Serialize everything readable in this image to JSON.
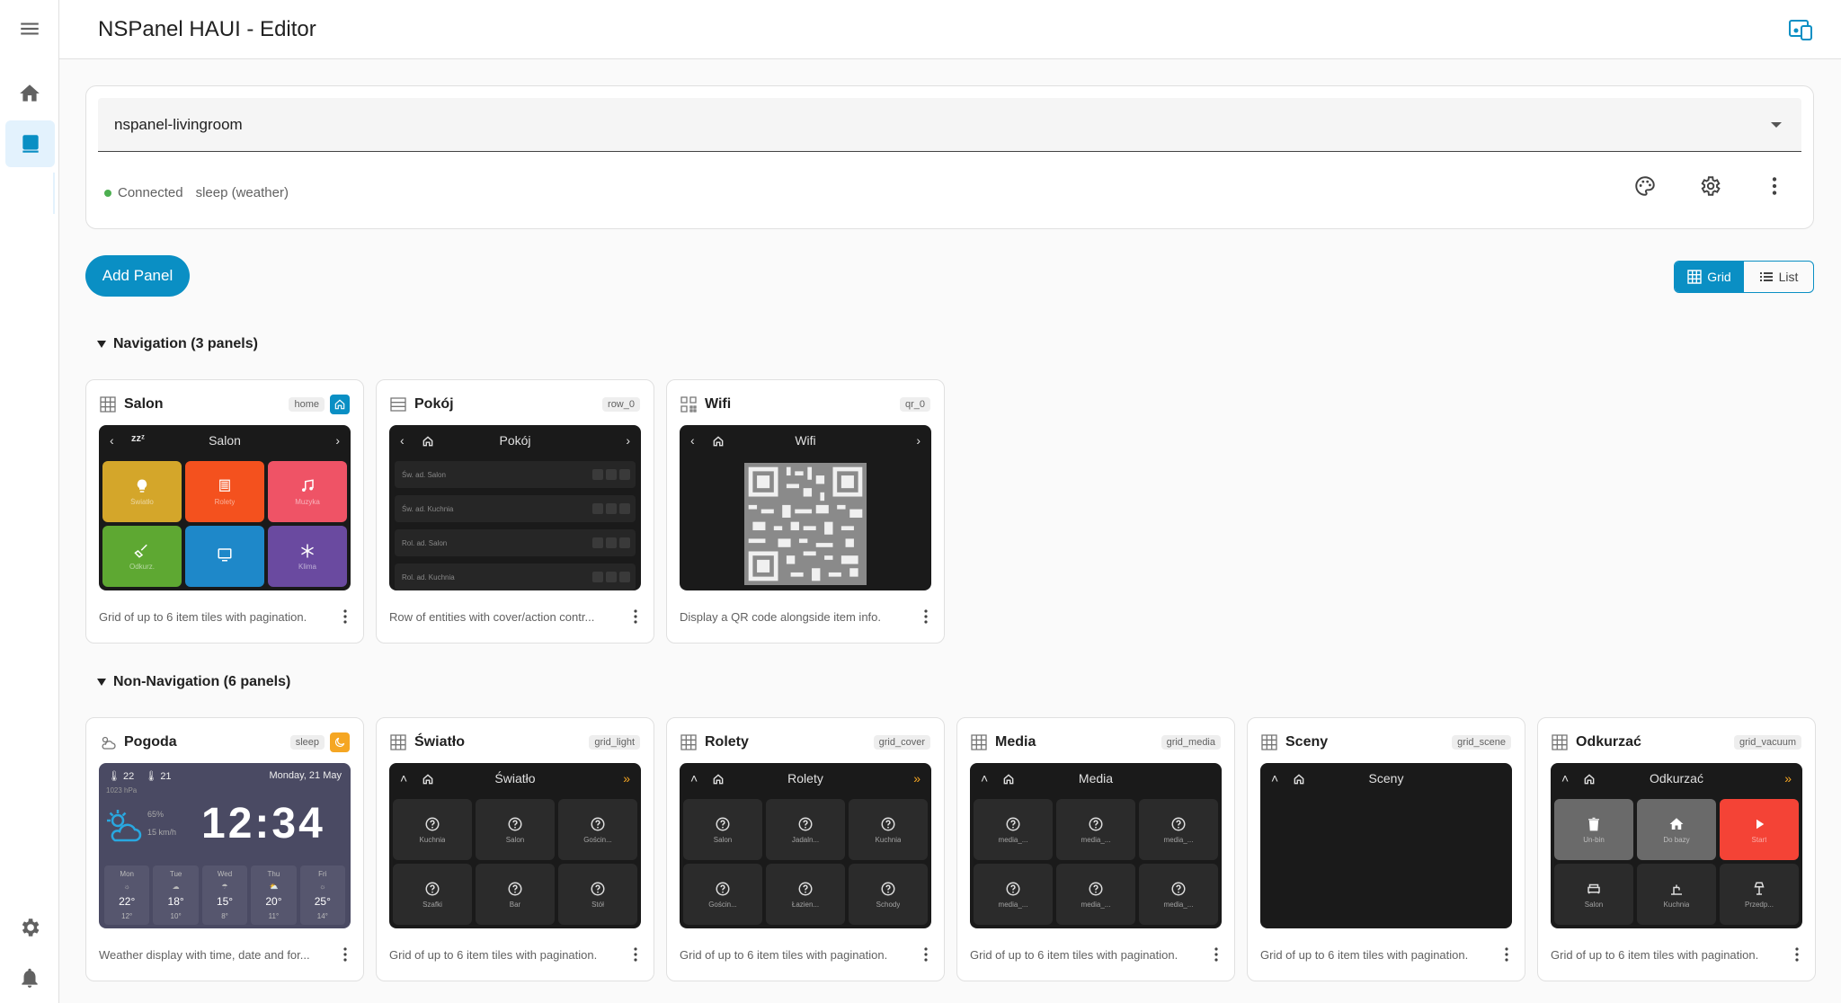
{
  "header": {
    "title": "NSPanel HAUI - Editor"
  },
  "device": {
    "selected": "nspanel-livingroom",
    "status": "Connected",
    "mode": "sleep (weather)"
  },
  "toolbar": {
    "add_panel": "Add Panel",
    "view_grid": "Grid",
    "view_list": "List"
  },
  "sections": {
    "navigation": "Navigation (3 panels)",
    "non_navigation": "Non-Navigation (6 panels)"
  },
  "colors": {
    "accent": "#0a8fc4",
    "connected": "#4caf50",
    "sleep_badge": "#f5a623"
  },
  "panels": {
    "salon": {
      "name": "Salon",
      "tag": "home",
      "title": "Salon",
      "tiles": [
        "Światło",
        "Rolety",
        "Muzyka",
        "Odkurz.",
        "",
        "Klima"
      ],
      "desc": "Grid of up to 6 item tiles with pagination."
    },
    "pokoj": {
      "name": "Pokój",
      "tag": "row_0",
      "title": "Pokój",
      "rows": [
        "Św. ad. Salon",
        "Św. ad. Kuchnia",
        "Rol. ad. Salon",
        "Rol. ad. Kuchnia"
      ],
      "desc": "Row of entities with cover/action contr..."
    },
    "wifi": {
      "name": "Wifi",
      "tag": "qr_0",
      "title": "Wifi",
      "desc": "Display a QR code alongside item info."
    },
    "pogoda": {
      "name": "Pogoda",
      "tag": "sleep",
      "temp_out": "22",
      "temp_in": "21",
      "pressure": "1023 hPa",
      "date": "Monday, 21 May",
      "time": "12:34",
      "humidity": "65%",
      "wind": "15 km/h",
      "days": [
        {
          "d": "Mon",
          "t": "22°",
          "l": "12°"
        },
        {
          "d": "Tue",
          "t": "18°",
          "l": "10°"
        },
        {
          "d": "Wed",
          "t": "15°",
          "l": "8°"
        },
        {
          "d": "Thu",
          "t": "20°",
          "l": "11°"
        },
        {
          "d": "Fri",
          "t": "25°",
          "l": "14°"
        }
      ],
      "desc": "Weather display with time, date and for..."
    },
    "swiatlo": {
      "name": "Światło",
      "tag": "grid_light",
      "title": "Światło",
      "tiles": [
        "Kuchnia",
        "Salon",
        "Gościn...",
        "Szafki",
        "Bar",
        "Stół"
      ],
      "desc": "Grid of up to 6 item tiles with pagination."
    },
    "rolety": {
      "name": "Rolety",
      "tag": "grid_cover",
      "title": "Rolety",
      "tiles": [
        "Salon",
        "Jadaln...",
        "Kuchnia",
        "Gościn...",
        "Łazien...",
        "Schody"
      ],
      "desc": "Grid of up to 6 item tiles with pagination."
    },
    "media": {
      "name": "Media",
      "tag": "grid_media",
      "title": "Media",
      "tiles": [
        "media_...",
        "media_...",
        "media_...",
        "media_...",
        "media_...",
        "media_..."
      ],
      "desc": "Grid of up to 6 item tiles with pagination."
    },
    "sceny": {
      "name": "Sceny",
      "tag": "grid_scene",
      "title": "Sceny",
      "desc": "Grid of up to 6 item tiles with pagination."
    },
    "odkurzac": {
      "name": "Odkurzać",
      "tag": "grid_vacuum",
      "title": "Odkurzać",
      "tiles": [
        "Un-bin",
        "Do bazy",
        "Start",
        "Salon",
        "Kuchnia",
        "Przedp..."
      ],
      "desc": "Grid of up to 6 item tiles with pagination."
    }
  }
}
